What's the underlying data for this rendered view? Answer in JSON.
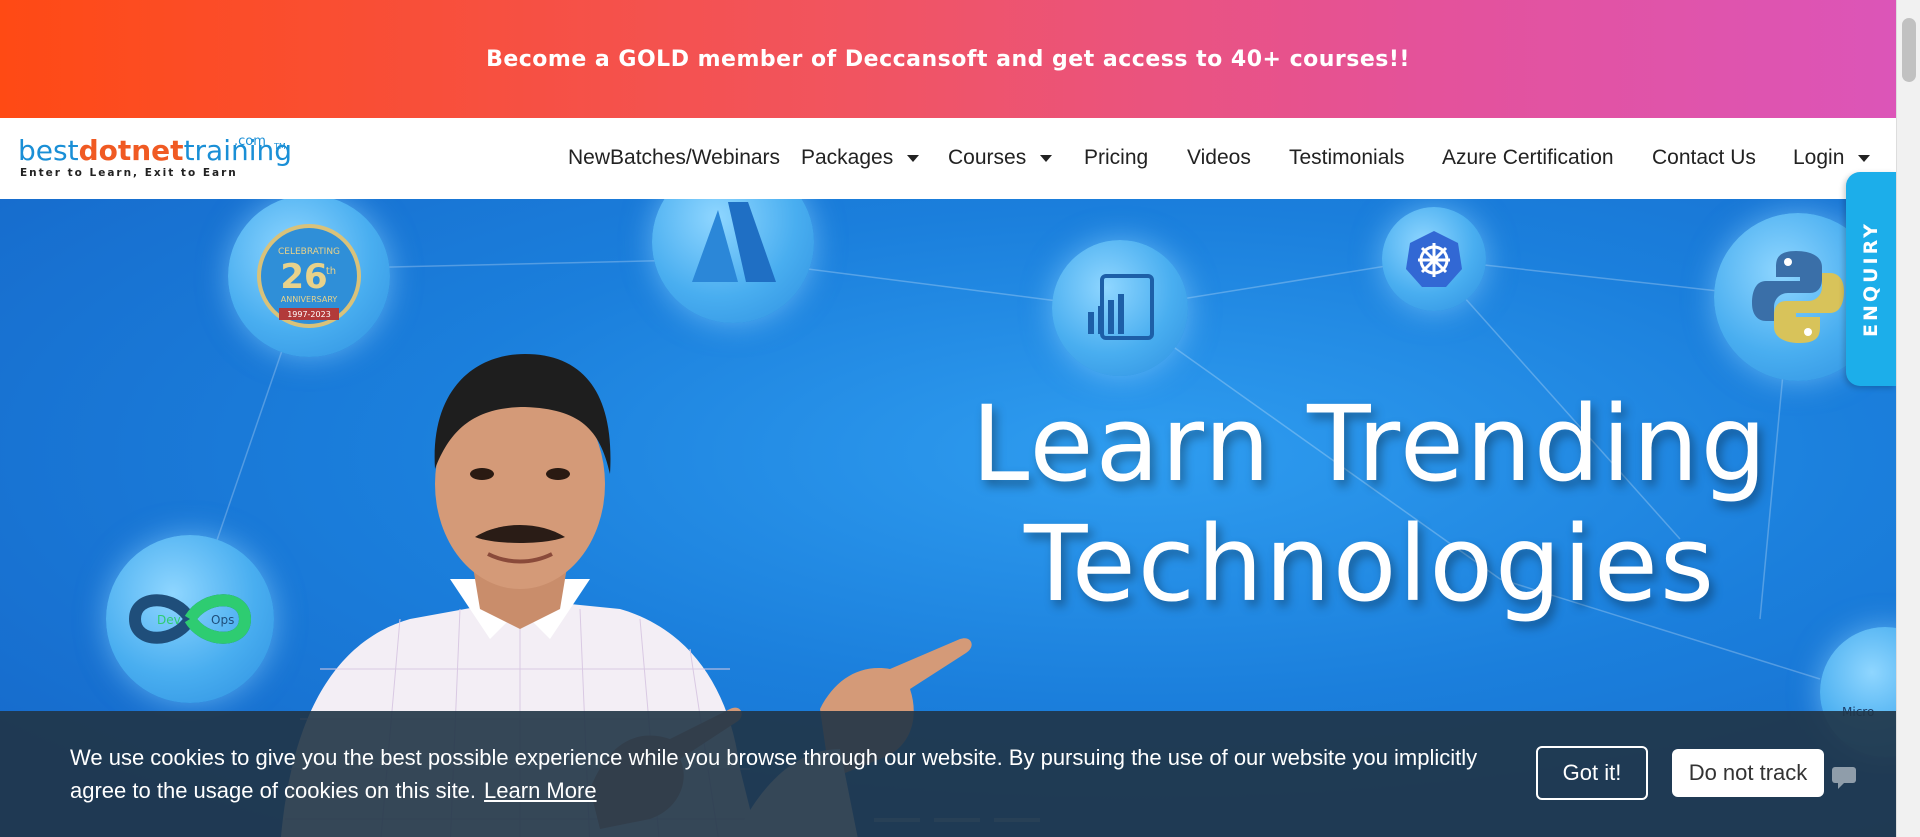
{
  "promo": {
    "text": "Become a GOLD member of Deccansoft and get access to 40+ courses!!"
  },
  "logo": {
    "part1": "best",
    "part2": "dotnet",
    "part3": "training",
    "com": ".com",
    "tm": "TM",
    "tagline": "Enter to Learn, Exit to Earn"
  },
  "nav": {
    "items": [
      {
        "label": "NewBatches/Webinars",
        "dropdown": false
      },
      {
        "label": "Packages",
        "dropdown": true
      },
      {
        "label": "Courses",
        "dropdown": true
      },
      {
        "label": "Pricing",
        "dropdown": false
      },
      {
        "label": "Videos",
        "dropdown": false
      },
      {
        "label": "Testimonials",
        "dropdown": false
      },
      {
        "label": "Azure Certification",
        "dropdown": false
      },
      {
        "label": "Contact Us",
        "dropdown": false
      },
      {
        "label": "Login",
        "dropdown": true
      }
    ]
  },
  "hero": {
    "headline_line1": "Learn Trending",
    "headline_line2": "Technologies",
    "badge": {
      "top": "CELEBRATING",
      "number": "26",
      "suffix": "th",
      "label": "ANNIVERSARY",
      "years": "1997-2023"
    },
    "devops": {
      "dev": "Dev",
      "ops": "Ops"
    },
    "partial_label": "Micro",
    "icons": [
      "anniversary-badge-icon",
      "azure-icon",
      "power-bi-icon",
      "kubernetes-icon",
      "python-icon",
      "devops-icon",
      "microsoft-icon"
    ]
  },
  "enquiry": {
    "label": "ENQUIRY"
  },
  "cookie": {
    "message": "We use cookies to give you the best possible experience while you browse through our website. By pursuing the use of our website you implicitly agree to the usage of cookies on this site.",
    "learn_more": "Learn More",
    "got_it": "Got it!",
    "do_not_track": "Do not track"
  },
  "colors": {
    "promo_start": "#ff4a14",
    "promo_end": "#dc55b8",
    "hero_blue": "#1b7fdc",
    "enquiry": "#1caeea",
    "cookie_bg": "#203446"
  }
}
